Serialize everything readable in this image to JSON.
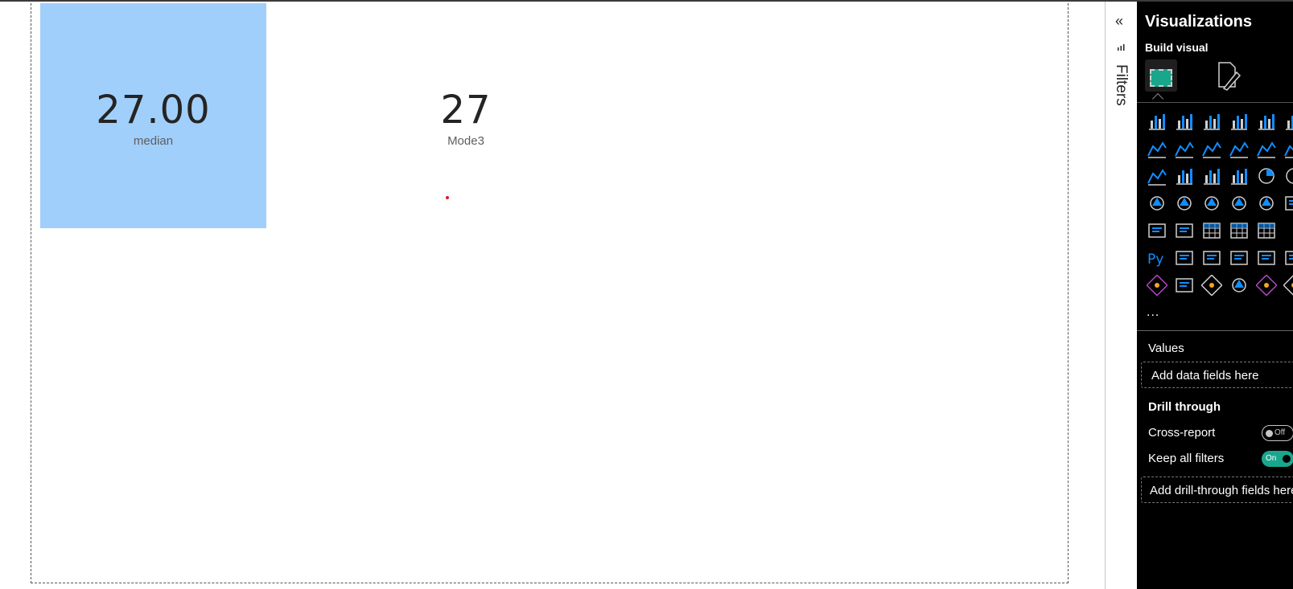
{
  "cards": {
    "median": {
      "value": "27.00",
      "label": "median"
    },
    "mode": {
      "value": "27",
      "label": "Mode3"
    }
  },
  "filters_pane": {
    "collapse_glyph": "«",
    "label": "Filters"
  },
  "viz_pane": {
    "title": "Visualizations",
    "build_visual": "Build visual",
    "more": "...",
    "values_label": "Values",
    "values_placeholder": "Add data fields here",
    "drill_through_label": "Drill through",
    "cross_report_label": "Cross-report",
    "cross_report_state": "Off",
    "keep_filters_label": "Keep all filters",
    "keep_filters_state": "On",
    "drill_placeholder": "Add drill-through fields here"
  },
  "viz_icons": [
    [
      "stacked-bar-chart-icon",
      "stacked-column-chart-icon",
      "clustered-bar-chart-icon",
      "clustered-column-chart-icon",
      "100-stacked-bar-chart-icon",
      "100-stacked-column-chart-icon"
    ],
    [
      "line-chart-icon",
      "area-chart-icon",
      "stacked-area-chart-icon",
      "100-stacked-area-chart-icon",
      "line-and-stacked-column-chart-icon",
      "line-and-clustered-column-chart-icon"
    ],
    [
      "ribbon-chart-icon",
      "waterfall-chart-icon",
      "funnel-chart-icon",
      "scatter-chart-icon",
      "pie-chart-icon",
      "donut-chart-icon"
    ],
    [
      "treemap-icon",
      "map-icon",
      "filled-map-icon",
      "azure-map-icon",
      "gauge-icon",
      "card-icon"
    ],
    [
      "multi-row-card-icon",
      "kpi-icon",
      "slicer-icon",
      "table-icon",
      "matrix-icon"
    ],
    [
      "python-visual-icon",
      "key-influencers-icon",
      "decomposition-tree-icon",
      "qa-icon",
      "smart-narrative-icon",
      "paginated-report-icon"
    ],
    [
      "power-apps-report-icon",
      "card-new-icon",
      "power-automate-icon",
      "arcgis-map-icon",
      "power-apps-icon",
      "power-bi-icon"
    ]
  ],
  "colors": {
    "card_fill": "#a0cffb",
    "accent": "#1aa68d",
    "icon_blue": "#118dff",
    "pane_bg": "#000000"
  }
}
